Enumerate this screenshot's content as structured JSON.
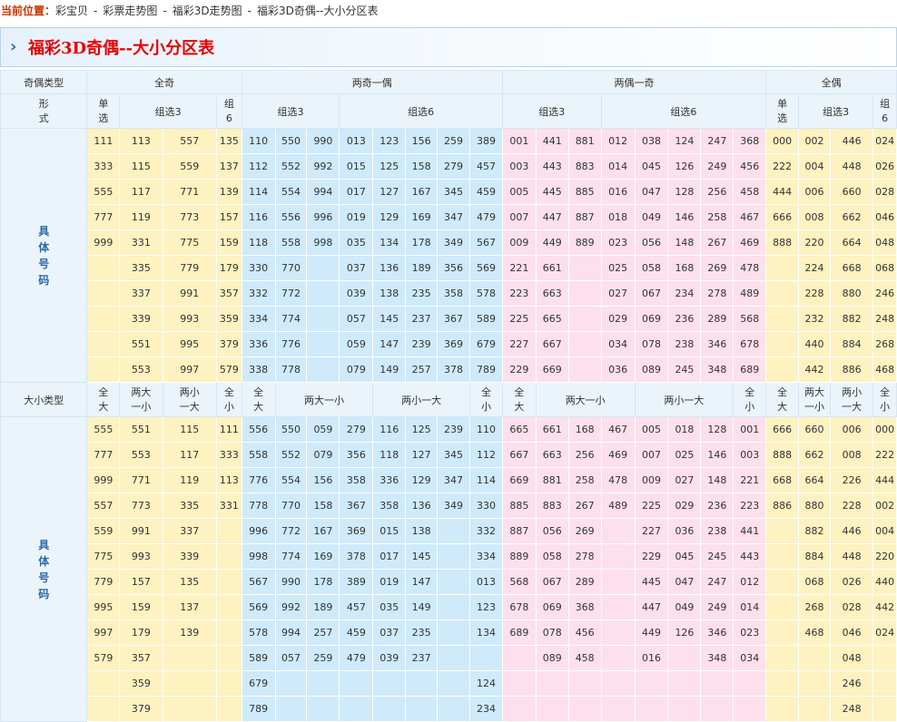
{
  "breadcrumb": {
    "label": "当前位置：",
    "items": [
      "彩宝贝",
      "彩票走势图",
      "福彩3D走势图",
      "福彩3D奇偶--大小分区表"
    ],
    "separator": "-"
  },
  "banner": {
    "arrow": "›",
    "title": "福彩3D奇偶--大小分区表"
  },
  "colors": {
    "yellow_zone": "#fdf2c0",
    "blue_zone": "#cfeafb",
    "pink_zone": "#fde0ec",
    "header_bg": "#ebf4fb",
    "title_red": "#e60000",
    "label_blue": "#2d6aa5"
  },
  "odd_even": {
    "type_label": "奇偶类型",
    "groups": [
      "全奇",
      "两奇一偶",
      "两偶一奇",
      "全偶"
    ],
    "form_label": "形\n式",
    "subheaders": [
      "单\n选",
      "组选3",
      "组\n6",
      "组选3",
      "组选6",
      "组选3",
      "组选6",
      "单\n选",
      "组选3",
      "组\n6"
    ],
    "row_label": "具\n体\n号\n码",
    "rows": [
      [
        "111",
        "113",
        "557",
        "135",
        "110",
        "550",
        "990",
        "013",
        "123",
        "156",
        "259",
        "389",
        "001",
        "441",
        "881",
        "012",
        "038",
        "124",
        "247",
        "368",
        "000",
        "002",
        "446",
        "024"
      ],
      [
        "333",
        "115",
        "559",
        "137",
        "112",
        "552",
        "992",
        "015",
        "125",
        "158",
        "279",
        "457",
        "003",
        "443",
        "883",
        "014",
        "045",
        "126",
        "249",
        "456",
        "222",
        "004",
        "448",
        "026"
      ],
      [
        "555",
        "117",
        "771",
        "139",
        "114",
        "554",
        "994",
        "017",
        "127",
        "167",
        "345",
        "459",
        "005",
        "445",
        "885",
        "016",
        "047",
        "128",
        "256",
        "458",
        "444",
        "006",
        "660",
        "028"
      ],
      [
        "777",
        "119",
        "773",
        "157",
        "116",
        "556",
        "996",
        "019",
        "129",
        "169",
        "347",
        "479",
        "007",
        "447",
        "887",
        "018",
        "049",
        "146",
        "258",
        "467",
        "666",
        "008",
        "662",
        "046"
      ],
      [
        "999",
        "331",
        "775",
        "159",
        "118",
        "558",
        "998",
        "035",
        "134",
        "178",
        "349",
        "567",
        "009",
        "449",
        "889",
        "023",
        "056",
        "148",
        "267",
        "469",
        "888",
        "220",
        "664",
        "048"
      ],
      [
        "",
        "335",
        "779",
        "179",
        "330",
        "770",
        "",
        "037",
        "136",
        "189",
        "356",
        "569",
        "221",
        "661",
        "",
        "025",
        "058",
        "168",
        "269",
        "478",
        "",
        "224",
        "668",
        "068"
      ],
      [
        "",
        "337",
        "991",
        "357",
        "332",
        "772",
        "",
        "039",
        "138",
        "235",
        "358",
        "578",
        "223",
        "663",
        "",
        "027",
        "067",
        "234",
        "278",
        "489",
        "",
        "228",
        "880",
        "246"
      ],
      [
        "",
        "339",
        "993",
        "359",
        "334",
        "774",
        "",
        "057",
        "145",
        "237",
        "367",
        "589",
        "225",
        "665",
        "",
        "029",
        "069",
        "236",
        "289",
        "568",
        "",
        "232",
        "882",
        "248"
      ],
      [
        "",
        "551",
        "995",
        "379",
        "336",
        "776",
        "",
        "059",
        "147",
        "239",
        "369",
        "679",
        "227",
        "667",
        "",
        "034",
        "078",
        "238",
        "346",
        "678",
        "",
        "440",
        "884",
        "268"
      ],
      [
        "",
        "553",
        "997",
        "579",
        "338",
        "778",
        "",
        "079",
        "149",
        "257",
        "378",
        "789",
        "229",
        "669",
        "",
        "036",
        "089",
        "245",
        "348",
        "689",
        "",
        "442",
        "886",
        "468"
      ]
    ]
  },
  "big_small": {
    "type_label": "大小类型",
    "subheaders": [
      "全\n大",
      "两大\n一小",
      "两小\n一大",
      "全\n小",
      "全\n大",
      "两大一小",
      "两小一大",
      "全\n小",
      "全\n大",
      "两大一小",
      "两小一大",
      "全\n小",
      "全\n大",
      "两大\n一小",
      "两小\n一大",
      "全\n小"
    ],
    "row_label": "具\n体\n号\n码",
    "rows": [
      [
        "555",
        "551",
        "115",
        "111",
        "556",
        "550",
        "059",
        "279",
        "116",
        "125",
        "239",
        "110",
        "665",
        "661",
        "168",
        "467",
        "005",
        "018",
        "128",
        "001",
        "666",
        "660",
        "006",
        "000"
      ],
      [
        "777",
        "553",
        "117",
        "333",
        "558",
        "552",
        "079",
        "356",
        "118",
        "127",
        "345",
        "112",
        "667",
        "663",
        "256",
        "469",
        "007",
        "025",
        "146",
        "003",
        "888",
        "662",
        "008",
        "222"
      ],
      [
        "999",
        "771",
        "119",
        "113",
        "776",
        "554",
        "156",
        "358",
        "336",
        "129",
        "347",
        "114",
        "669",
        "881",
        "258",
        "478",
        "009",
        "027",
        "148",
        "221",
        "668",
        "664",
        "226",
        "444"
      ],
      [
        "557",
        "773",
        "335",
        "331",
        "778",
        "770",
        "158",
        "367",
        "358",
        "136",
        "349",
        "330",
        "885",
        "883",
        "267",
        "489",
        "225",
        "029",
        "236",
        "223",
        "886",
        "880",
        "228",
        "002"
      ],
      [
        "559",
        "991",
        "337",
        "",
        "996",
        "772",
        "167",
        "369",
        "015",
        "138",
        "",
        "332",
        "887",
        "056",
        "269",
        "",
        "227",
        "036",
        "238",
        "441",
        "",
        "882",
        "446",
        "004"
      ],
      [
        "775",
        "993",
        "339",
        "",
        "998",
        "774",
        "169",
        "378",
        "017",
        "145",
        "",
        "334",
        "889",
        "058",
        "278",
        "",
        "229",
        "045",
        "245",
        "443",
        "",
        "884",
        "448",
        "220"
      ],
      [
        "779",
        "157",
        "135",
        "",
        "567",
        "990",
        "178",
        "389",
        "019",
        "147",
        "",
        "013",
        "568",
        "067",
        "289",
        "",
        "445",
        "047",
        "247",
        "012",
        "",
        "068",
        "026",
        "440"
      ],
      [
        "995",
        "159",
        "137",
        "",
        "569",
        "992",
        "189",
        "457",
        "035",
        "149",
        "",
        "123",
        "678",
        "069",
        "368",
        "",
        "447",
        "049",
        "249",
        "014",
        "",
        "268",
        "028",
        "442"
      ],
      [
        "997",
        "179",
        "139",
        "",
        "578",
        "994",
        "257",
        "459",
        "037",
        "235",
        "",
        "134",
        "689",
        "078",
        "456",
        "",
        "449",
        "126",
        "346",
        "023",
        "",
        "468",
        "046",
        "024"
      ],
      [
        "579",
        "357",
        "",
        "",
        "589",
        "057",
        "259",
        "479",
        "039",
        "237",
        "",
        "",
        "",
        "089",
        "458",
        "",
        "016",
        "",
        "348",
        "034",
        "",
        "",
        "048",
        ""
      ],
      [
        "",
        "359",
        "",
        "",
        "679",
        "",
        "",
        "",
        "",
        "",
        "",
        "124",
        "",
        "",
        "",
        "",
        "",
        "",
        "",
        "",
        "",
        "",
        "246",
        ""
      ],
      [
        "",
        "379",
        "",
        "",
        "789",
        "",
        "",
        "",
        "",
        "",
        "",
        "234",
        "",
        "",
        "",
        "",
        "",
        "",
        "",
        "",
        "",
        "",
        "248",
        ""
      ]
    ]
  }
}
